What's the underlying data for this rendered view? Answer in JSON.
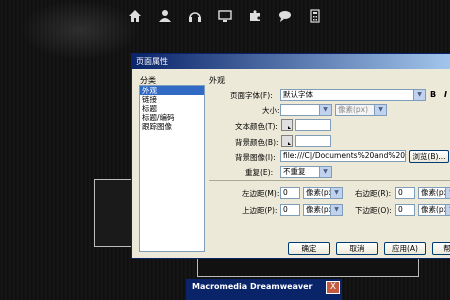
{
  "colors": {
    "title_bar": "#0a246a",
    "selection": "#316ac5",
    "dialog_bg": "#ece9d8"
  },
  "top_icons": [
    "home-icon",
    "user-icon",
    "headphones-icon",
    "monitor-icon",
    "puzzle-icon",
    "chat-icon",
    "calculator-icon"
  ],
  "dialog": {
    "title": "页面属性",
    "category_header": "分类",
    "categories": [
      "外观",
      "链接",
      "标题",
      "标题/编码",
      "跟踪图像"
    ],
    "section_title": "外观",
    "fields": {
      "page_font_label": "页面字体(F):",
      "page_font_value": "默认字体",
      "bold": "B",
      "italic": "I",
      "size_label": "大小:",
      "size_value": "",
      "size_unit": "像素(px)",
      "text_color_label": "文本颜色(T):",
      "bg_color_label": "背景颜色(B):",
      "bg_image_label": "背景图像(I):",
      "bg_image_value": "file:///C|/Documents%20and%20Settin",
      "browse_label": "浏览(B)...",
      "repeat_label": "重复(E):",
      "repeat_value": "不重复",
      "left_margin_label": "左边距(M):",
      "left_margin_value": "0",
      "left_margin_unit": "像素(px)",
      "right_margin_label": "右边距(R):",
      "right_margin_value": "0",
      "right_margin_unit": "像素(px)",
      "top_margin_label": "上边距(P):",
      "top_margin_value": "0",
      "top_margin_unit": "像素(px)",
      "bottom_margin_label": "下边距(O):",
      "bottom_margin_value": "0",
      "bottom_margin_unit": "像素(px)"
    },
    "buttons": {
      "ok": "确定",
      "cancel": "取消",
      "apply": "应用(A)",
      "help": "帮"
    }
  },
  "dreamweaver": {
    "title": "Macromedia Dreamweaver",
    "close": "X"
  }
}
